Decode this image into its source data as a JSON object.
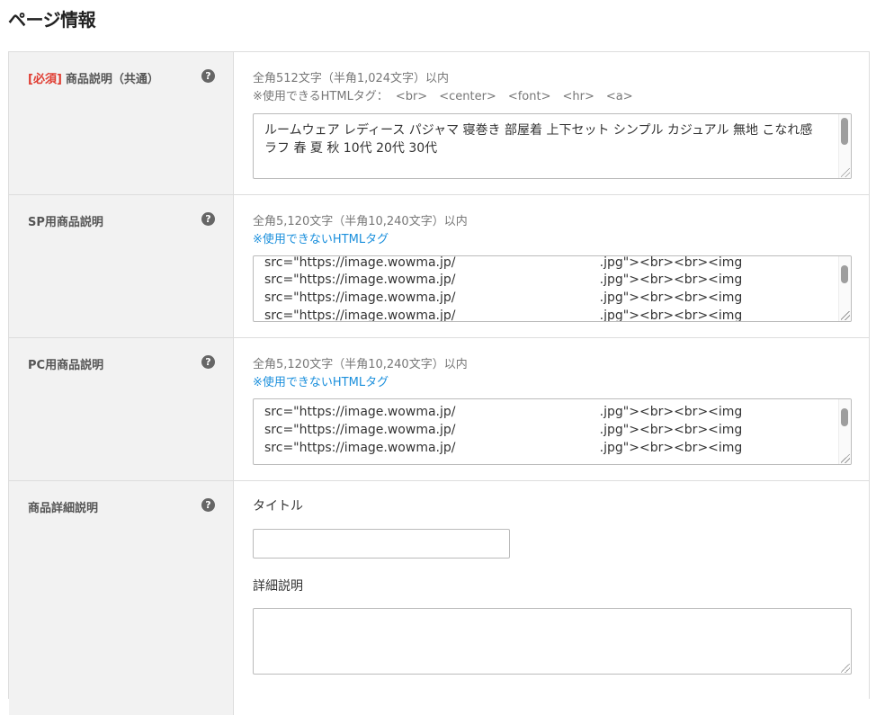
{
  "page": {
    "title": "ページ情報"
  },
  "rows": [
    {
      "required_tag": "[必須]",
      "label": "商品説明（共通）",
      "help_icon": "question-circle-icon",
      "limit": "全角512文字（半角1,024文字）以内",
      "html_note_prefix": "※使用できるHTMLタグ：",
      "html_tags": [
        "<br>",
        "<center>",
        "<font>",
        "<hr>",
        "<a>"
      ],
      "textarea_lines": [
        "ルームウェア レディース パジャマ 寝巻き 部屋着 上下セット シンプル カジュアル 無地 こなれ感",
        "ラフ 春 夏 秋 10代 20代 30代"
      ]
    },
    {
      "label": "SP用商品説明",
      "help_icon": "question-circle-icon",
      "limit": "全角5,120文字（半角10,240文字）以内",
      "link": "※使用できないHTMLタグ",
      "textarea_lines": [
        "src=\"https://image.wowma.jp/                                    .jpg\"><br><br><img",
        "src=\"https://image.wowma.jp/                                    .jpg\"><br><br><img",
        "src=\"https://image.wowma.jp/                                    .jpg\"><br><br><img",
        "src=\"https://image.wowma.jp/                                    .jpg\"><br><br><img"
      ]
    },
    {
      "label": "PC用商品説明",
      "help_icon": "question-circle-icon",
      "limit": "全角5,120文字（半角10,240文字）以内",
      "link": "※使用できないHTMLタグ",
      "textarea_lines": [
        "src=\"https://image.wowma.jp/                                    .jpg\"><br><br><img",
        "src=\"https://image.wowma.jp/                                    .jpg\"><br><br><img",
        "src=\"https://image.wowma.jp/                                    .jpg\"><br><br><img"
      ]
    },
    {
      "label": "商品詳細説明",
      "help_icon": "question-circle-icon",
      "title_label": "タイトル",
      "title_value": "",
      "detail_label": "詳細説明",
      "detail_value": ""
    }
  ]
}
